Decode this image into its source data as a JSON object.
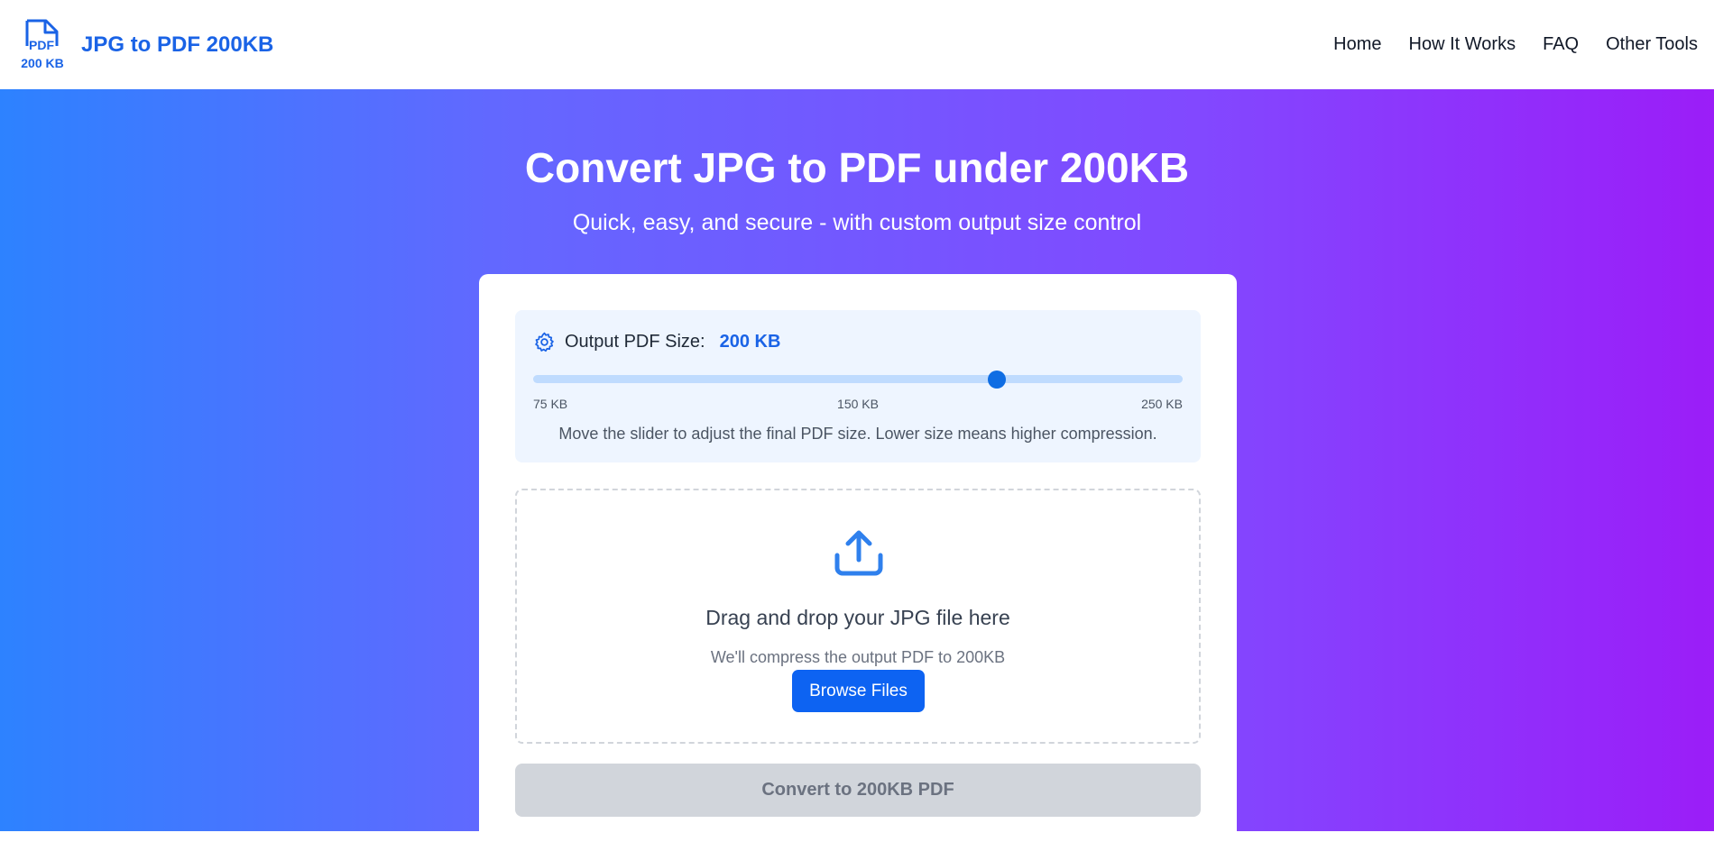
{
  "brand": {
    "logo_text_top": "PDF",
    "logo_text_bottom": "200 KB",
    "name": "JPG to PDF 200KB"
  },
  "nav": {
    "links": [
      "Home",
      "How It Works",
      "FAQ",
      "Other Tools"
    ]
  },
  "hero": {
    "title": "Convert JPG to PDF under 200KB",
    "subtitle": "Quick, easy, and secure - with custom output size control"
  },
  "size_control": {
    "label": "Output PDF Size:",
    "value_text": "200 KB",
    "min_label": "75 KB",
    "mid_label": "150 KB",
    "max_label": "250 KB",
    "min": 75,
    "max": 250,
    "value": 200,
    "help": "Move the slider to adjust the final PDF size. Lower size means higher compression."
  },
  "dropzone": {
    "icon": "upload-icon",
    "title": "Drag and drop your JPG file here",
    "subtitle": "We'll compress the output PDF to 200KB",
    "browse_label": "Browse Files"
  },
  "convert": {
    "label": "Convert to 200KB PDF"
  },
  "colors": {
    "brand_blue": "#1a63e6",
    "button_blue": "#0d63f2",
    "gradient_start": "#2d82ff",
    "gradient_end": "#9b1df8",
    "disabled_gray": "#d1d5db"
  }
}
